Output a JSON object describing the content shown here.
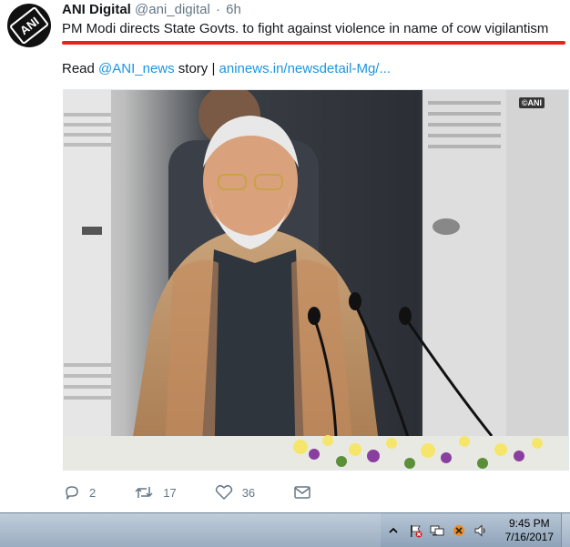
{
  "tweet": {
    "display_name": "ANI Digital",
    "screen_name": "@ani_digital",
    "dot": "·",
    "time": "6h",
    "headline": "PM Modi directs State Govts. to fight against violence in name of cow vigilantism",
    "read_prefix": "Read ",
    "read_mention": "@ANI_news",
    "read_middle": " story | ",
    "read_link": "aninews.in/newsdetail-Mg/...",
    "avatar_text": "ANI",
    "media_watermark": "©ANI",
    "actions": {
      "reply_count": "2",
      "retweet_count": "17",
      "like_count": "36"
    }
  },
  "taskbar": {
    "time": "9:45 PM",
    "date": "7/16/2017",
    "tray_icons": [
      "chevron-up-icon",
      "action-center-flag-icon",
      "network-icon",
      "app-tray-icon",
      "volume-icon"
    ]
  },
  "colors": {
    "link": "#1b95e0",
    "underline": "#e5221c",
    "muted": "#657786"
  }
}
